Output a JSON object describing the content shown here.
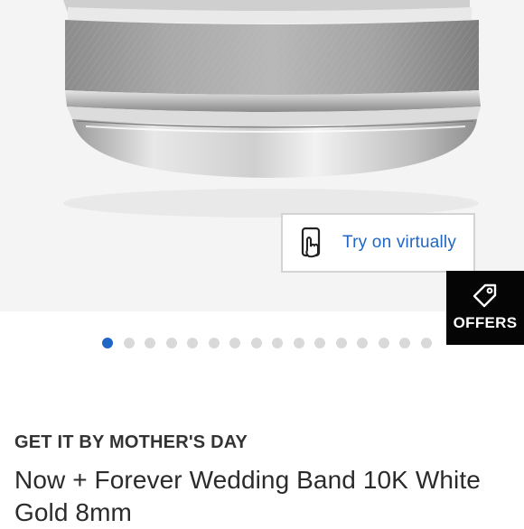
{
  "try_on": {
    "label": "Try on virtually",
    "icon": "hand-phone-icon"
  },
  "offers": {
    "label": "OFFERS",
    "icon": "tag-icon"
  },
  "carousel": {
    "total": 16,
    "active_index": 0
  },
  "delivery_note": "GET IT BY MOTHER'S DAY",
  "product": {
    "title": "Now + Forever Wedding Band 10K White Gold 8mm"
  },
  "colors": {
    "accent": "#1f66c7",
    "offers_bg": "#050505",
    "dot_inactive": "#d9d9d9",
    "text": "#2b2b2b"
  }
}
